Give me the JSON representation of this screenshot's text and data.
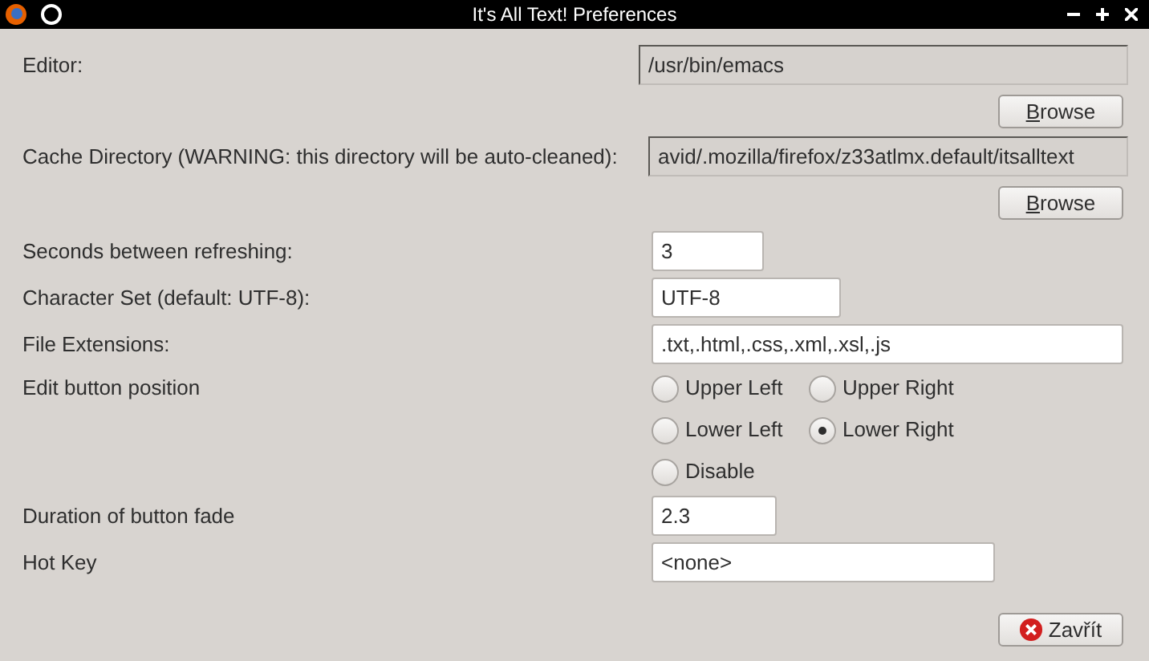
{
  "window": {
    "title": "It's All Text! Preferences"
  },
  "settings": [
    {
      "kind": "path",
      "label": "Editor:",
      "field": {
        "value": "/usr/bin/emacs",
        "readonly": true
      },
      "button": {
        "label": "Browse"
      }
    },
    {
      "kind": "path",
      "label": "Cache Directory (WARNING: this directory will be auto-cleaned):",
      "field": {
        "value": "avid/.mozilla/firefox/z33atlmx.default/itsalltext",
        "readonly": true
      },
      "button": {
        "label": "Browse"
      }
    },
    {
      "kind": "text",
      "label": "Seconds between refreshing:",
      "field": {
        "value": "3",
        "readonly": false
      }
    },
    {
      "kind": "text",
      "label": "Character Set (default: UTF-8):",
      "field": {
        "value": "UTF-8",
        "readonly": false
      }
    },
    {
      "kind": "text",
      "label": "File Extensions:",
      "field": {
        "value": ".txt,.html,.css,.xml,.xsl,.js",
        "readonly": false
      }
    },
    {
      "kind": "radios",
      "label": "Edit button position",
      "options": [
        {
          "label": "Upper Left",
          "selected": false
        },
        {
          "label": "Upper Right",
          "selected": false
        },
        {
          "label": "Lower Left",
          "selected": false
        },
        {
          "label": "Lower Right",
          "selected": true
        },
        {
          "label": "Disable",
          "selected": false
        }
      ]
    },
    {
      "kind": "text",
      "label": "Duration of button fade",
      "field": {
        "value": "2.3",
        "readonly": false
      }
    },
    {
      "kind": "text",
      "label": "Hot Key",
      "field": {
        "value": "<none>",
        "readonly": false
      }
    }
  ],
  "close_button": {
    "label": "Zavřít"
  }
}
